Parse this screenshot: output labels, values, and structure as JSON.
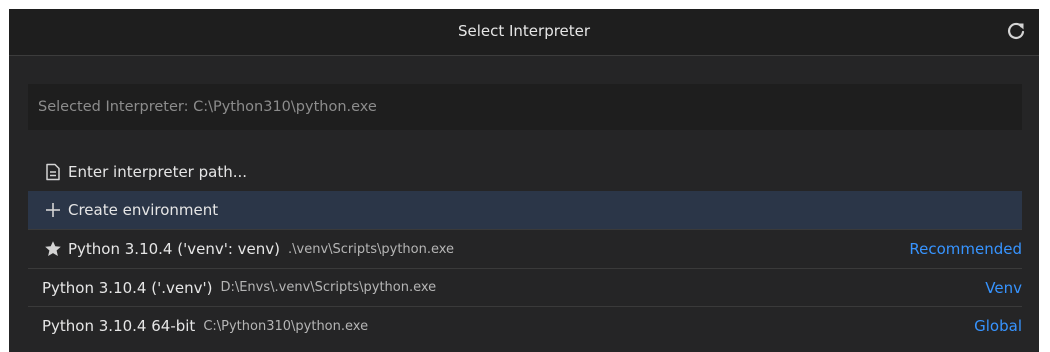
{
  "title": "Select Interpreter",
  "refresh_icon": "refresh-icon",
  "search": {
    "placeholder": "Selected Interpreter: C:\\Python310\\python.exe",
    "value": ""
  },
  "items": [
    {
      "icon": "file-icon",
      "label": "Enter interpreter path...",
      "desc": "",
      "tag": ""
    },
    {
      "icon": "plus-icon",
      "label": "Create environment",
      "desc": "",
      "tag": ""
    },
    {
      "icon": "star-icon",
      "label": "Python 3.10.4 ('venv': venv)",
      "desc": ".\\venv\\Scripts\\python.exe",
      "tag": "Recommended"
    },
    {
      "icon": "",
      "label": "Python 3.10.4 ('.venv')",
      "desc": "D:\\Envs\\.venv\\Scripts\\python.exe",
      "tag": "Venv"
    },
    {
      "icon": "",
      "label": "Python 3.10.4 64-bit",
      "desc": "C:\\Python310\\python.exe",
      "tag": "Global"
    }
  ],
  "colors": {
    "panel_bg": "#252526",
    "title_bg": "#1e1e1e",
    "selected_bg": "#2b3648",
    "accent": "#3794ff",
    "text": "#e6e6e6",
    "muted": "#b5b5b5"
  }
}
